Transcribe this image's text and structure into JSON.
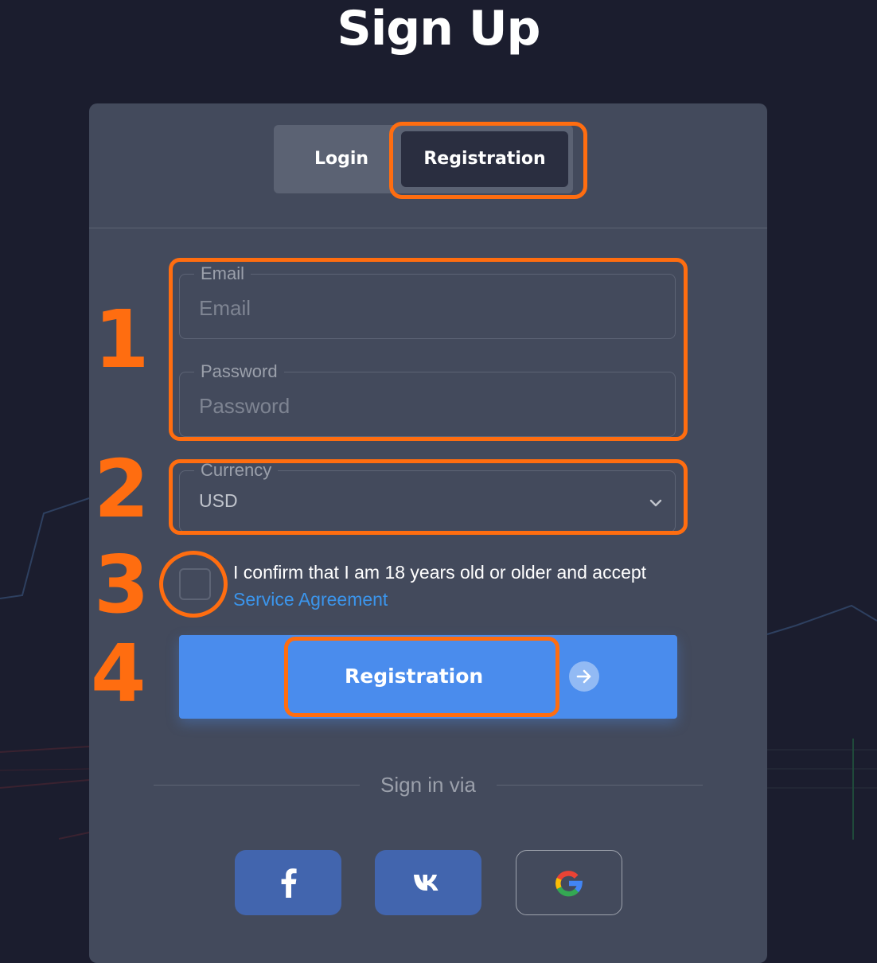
{
  "page": {
    "title": "Sign Up"
  },
  "tabs": [
    {
      "label": "Login"
    },
    {
      "label": "Registration",
      "active": true
    }
  ],
  "form": {
    "email": {
      "label": "Email",
      "placeholder": "Email"
    },
    "password": {
      "label": "Password",
      "placeholder": "Password"
    },
    "currency": {
      "label": "Currency",
      "value": "USD"
    },
    "consent": {
      "text": "I confirm that I am 18 years old or older and accept",
      "link": "Service Agreement",
      "checked": false
    },
    "submit_label": "Registration"
  },
  "sign_in_via": {
    "label": "Sign in via",
    "providers": [
      {
        "name": "facebook",
        "icon": "facebook-icon"
      },
      {
        "name": "vk",
        "icon": "vk-icon"
      },
      {
        "name": "google",
        "icon": "google-icon"
      }
    ]
  },
  "annotations": {
    "step_numbers": [
      "1",
      "2",
      "3",
      "4"
    ],
    "color": "#ff6d10"
  },
  "colors": {
    "background": "#1b1d2e",
    "card": "#434a5c",
    "accent_blue": "#4a8ced",
    "link_blue": "#3b95ec",
    "social_blue": "#4265ae"
  }
}
